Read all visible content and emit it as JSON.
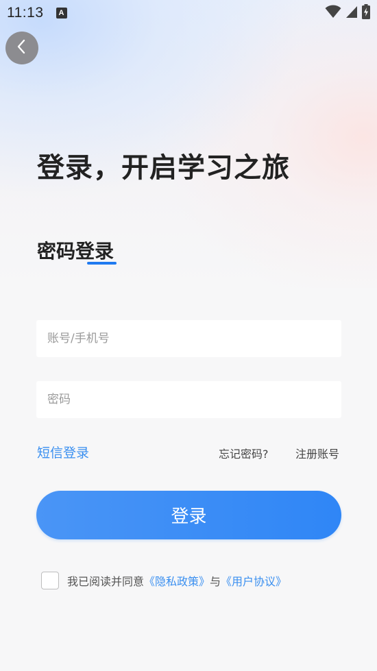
{
  "status_bar": {
    "time": "11:13",
    "notification_icon_letter": "A",
    "icons": [
      "wifi-icon",
      "signal-icon",
      "battery-charging-icon"
    ]
  },
  "nav": {
    "back_icon": "chevron-left-icon"
  },
  "headline": "登录，开启学习之旅",
  "tab": {
    "title": "密码登录"
  },
  "form": {
    "account_placeholder": "账号/手机号",
    "account_value": "",
    "password_placeholder": "密码",
    "password_value": ""
  },
  "links": {
    "sms_login": "短信登录",
    "forgot_password": "忘记密码?",
    "register": "注册账号"
  },
  "login_button": "登录",
  "agreement": {
    "checked": false,
    "prefix": "我已阅读并同意",
    "privacy_policy": "《隐私政策》",
    "conjunction": "与",
    "user_agreement": "《用户协议》"
  },
  "colors": {
    "accent": "#2f86f6",
    "link": "#3a8ff0",
    "text_dark": "#222222",
    "back_button_bg": "#8c8c90"
  }
}
